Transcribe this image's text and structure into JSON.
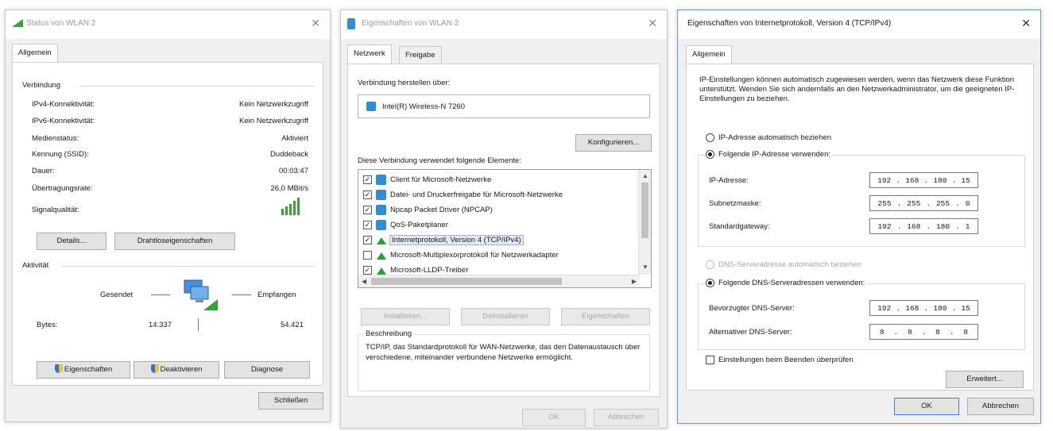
{
  "status_dialog": {
    "title": "Status von WLAN 2",
    "tab": "Allgemein",
    "connection_group": "Verbindung",
    "rows": [
      {
        "label": "IPv4-Konnektivität:",
        "value": "Kein Netzwerkzugriff"
      },
      {
        "label": "IPv6-Konnektivität:",
        "value": "Kein Netzwerkzugriff"
      },
      {
        "label": "Medienstatus:",
        "value": "Aktiviert"
      },
      {
        "label": "Kennung (SSID):",
        "value": "Duddeback"
      },
      {
        "label": "Dauer:",
        "value": "00:03:47"
      },
      {
        "label": "Übertragungsrate:",
        "value": "26,0 MBit/s"
      }
    ],
    "signal_label": "Signalqualität:",
    "details_button": "Details...",
    "wireless_props_button": "Drahtloseigenschaften",
    "activity_group": "Aktivität",
    "sent_label": "Gesendet",
    "received_label": "Empfangen",
    "bytes_label": "Bytes:",
    "bytes_sent": "14.337",
    "bytes_received": "54.421",
    "properties_button": "Eigenschaften",
    "disable_button": "Deaktivieren",
    "diagnose_button": "Diagnose",
    "close_button": "Schließen"
  },
  "props_dialog": {
    "title": "Eigenschaften von WLAN 2",
    "tabs": [
      "Netzwerk",
      "Freigabe"
    ],
    "connect_using_label": "Verbindung herstellen über:",
    "adapter_name": "Intel(R) Wireless-N 7260",
    "configure_button": "Konfigurieren...",
    "elements_label": "Diese Verbindung verwendet folgende Elemente:",
    "items": [
      {
        "label": "Client für Microsoft-Netzwerke",
        "checked": true,
        "icon": "network-client-icon"
      },
      {
        "label": "Datei- und Druckerfreigabe für Microsoft-Netzwerke",
        "checked": true,
        "icon": "network-client-icon"
      },
      {
        "label": "Npcap Packet Driver (NPCAP)",
        "checked": true,
        "icon": "network-client-icon"
      },
      {
        "label": "QoS-Paketplaner",
        "checked": true,
        "icon": "network-client-icon"
      },
      {
        "label": "Internetprotokoll, Version 4 (TCP/IPv4)",
        "checked": true,
        "icon": "protocol-icon"
      },
      {
        "label": "Microsoft-Multiplexorprotokoll für Netzwerkadapter",
        "checked": false,
        "icon": "protocol-icon"
      },
      {
        "label": "Microsoft-LLDP-Treiber",
        "checked": true,
        "icon": "protocol-icon"
      }
    ],
    "install_button": "Installieren...",
    "uninstall_button": "Deinstallieren",
    "properties_button": "Eigenschaften",
    "description_group": "Beschreibung",
    "description_text": "TCP/IP, das Standardprotokoll für WAN-Netzwerke, das den Datenaustausch über verschiedene, miteinander verbundene Netzwerke ermöglicht.",
    "ok_button": "OK",
    "cancel_button": "Abbrechen"
  },
  "ipv4_dialog": {
    "title": "Eigenschaften von Internetprotokoll, Version 4 (TCP/IPv4)",
    "tab": "Allgemein",
    "intro_text": "IP-Einstellungen können automatisch zugewiesen werden, wenn das Netzwerk diese Funktion unterstützt. Wenden Sie sich andernfalls an den Netzwerkadministrator, um die geeigneten IP-Einstellungen zu beziehen.",
    "auto_ip_radio": "IP-Adresse automatisch beziehen",
    "manual_ip_radio": "Folgende IP-Adresse verwenden:",
    "ip_label": "IP-Adresse:",
    "ip_value": [
      "192",
      "168",
      "180",
      "15"
    ],
    "subnet_label": "Subnetzmaske:",
    "subnet_value": [
      "255",
      "255",
      "255",
      "0"
    ],
    "gateway_label": "Standardgateway:",
    "gateway_value": [
      "192",
      "168",
      "180",
      "1"
    ],
    "auto_dns_radio": "DNS-Serveradresse automatisch beziehen",
    "manual_dns_radio": "Folgende DNS-Serveradressen verwenden:",
    "preferred_dns_label": "Bevorzugter DNS-Server:",
    "preferred_dns_value": [
      "192",
      "168",
      "180",
      "15"
    ],
    "alternate_dns_label": "Alternativer DNS-Server:",
    "alternate_dns_value": [
      "8",
      "8",
      "8",
      "8"
    ],
    "validate_checkbox": "Einstellungen beim Beenden überprüfen",
    "advanced_button": "Erweitert...",
    "ok_button": "OK",
    "cancel_button": "Abbrechen"
  }
}
